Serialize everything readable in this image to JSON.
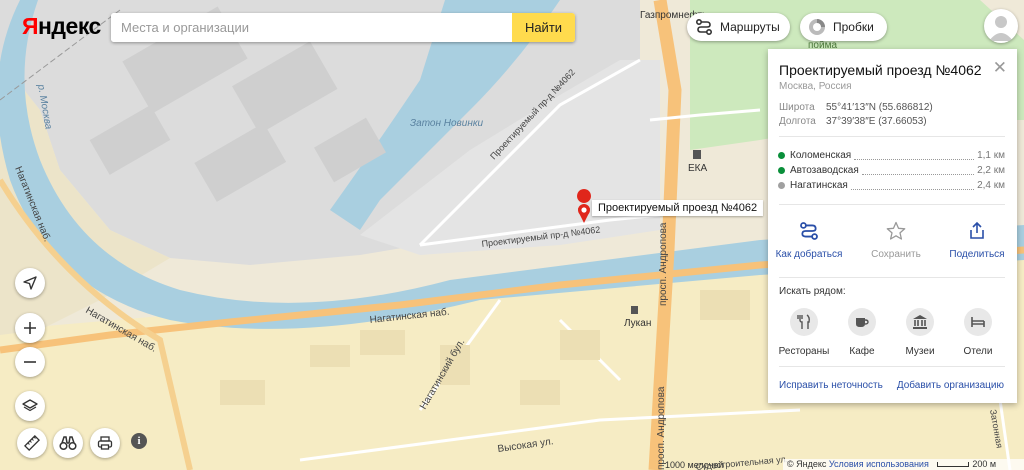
{
  "header": {
    "logo_first": "Я",
    "logo_rest": "ндекс",
    "search_placeholder": "Места и организации",
    "search_button": "Найти",
    "routes_label": "Маршруты",
    "traffic_label": "Пробки"
  },
  "map": {
    "labels": {
      "gazpromneft": "Газпромнефть",
      "zaton": "Затон Новинки",
      "river": "р. Москва",
      "proezd_upper": "Проектируемый пр-д №4062",
      "proezd_lower": "Проектируемый пр-д №4062",
      "nagat_nab_left": "Нагатинская наб.",
      "nagat_nab_mid": "Нагатинская наб.",
      "nagat_nab_main": "Нагатинская наб.",
      "andropova_upper": "просп. Андропова",
      "andropova_lower": "просп. Андропова",
      "nagat_bul": "Нагатинский бул.",
      "vysokaya": "Высокая ул.",
      "sudostr": "Судостроительная ул.",
      "zatonnaya": "Затонная",
      "eka": "ЕКА",
      "lukan": "Лукан",
      "poima_top": "пойма",
      "poima_partial": "пойма",
      "home_1000": "1000 мелочей"
    },
    "pin_label": "Проектируемый проезд №4062"
  },
  "card": {
    "title": "Проектируемый проезд №4062",
    "subtitle": "Москва, Россия",
    "lat_label": "Широта",
    "lat_value": "55°41′13″N (55.686812)",
    "lon_label": "Долгота",
    "lon_value": "37°39′38″E (37.66053)",
    "metro": [
      {
        "name": "Коломенская",
        "dist": "1,1 км",
        "color": "#0a8f3a"
      },
      {
        "name": "Автозаводская",
        "dist": "2,2 км",
        "color": "#0a8f3a"
      },
      {
        "name": "Нагатинская",
        "dist": "2,4 км",
        "color": "#a0a0a0"
      }
    ],
    "actions": {
      "route": "Как добраться",
      "save": "Сохранить",
      "share": "Поделиться"
    },
    "nearby_title": "Искать рядом:",
    "nearby": {
      "restaurants": "Рестораны",
      "cafe": "Кафе",
      "museums": "Музеи",
      "hotels": "Отели"
    },
    "fix_link": "Исправить неточность",
    "add_org_link": "Добавить организацию"
  },
  "footer": {
    "copyright": "© Яндекс",
    "terms": "Условия использования",
    "scale": "200 м"
  },
  "colors": {
    "water": "#a9cfe0",
    "industrial": "#dcdcdc",
    "residential": "#f6ecc4",
    "park": "#cde9bd",
    "major_road": "#f7c27a",
    "accent": "#ffdb4d",
    "pin": "#e0261b",
    "link": "#2a4fa8"
  }
}
